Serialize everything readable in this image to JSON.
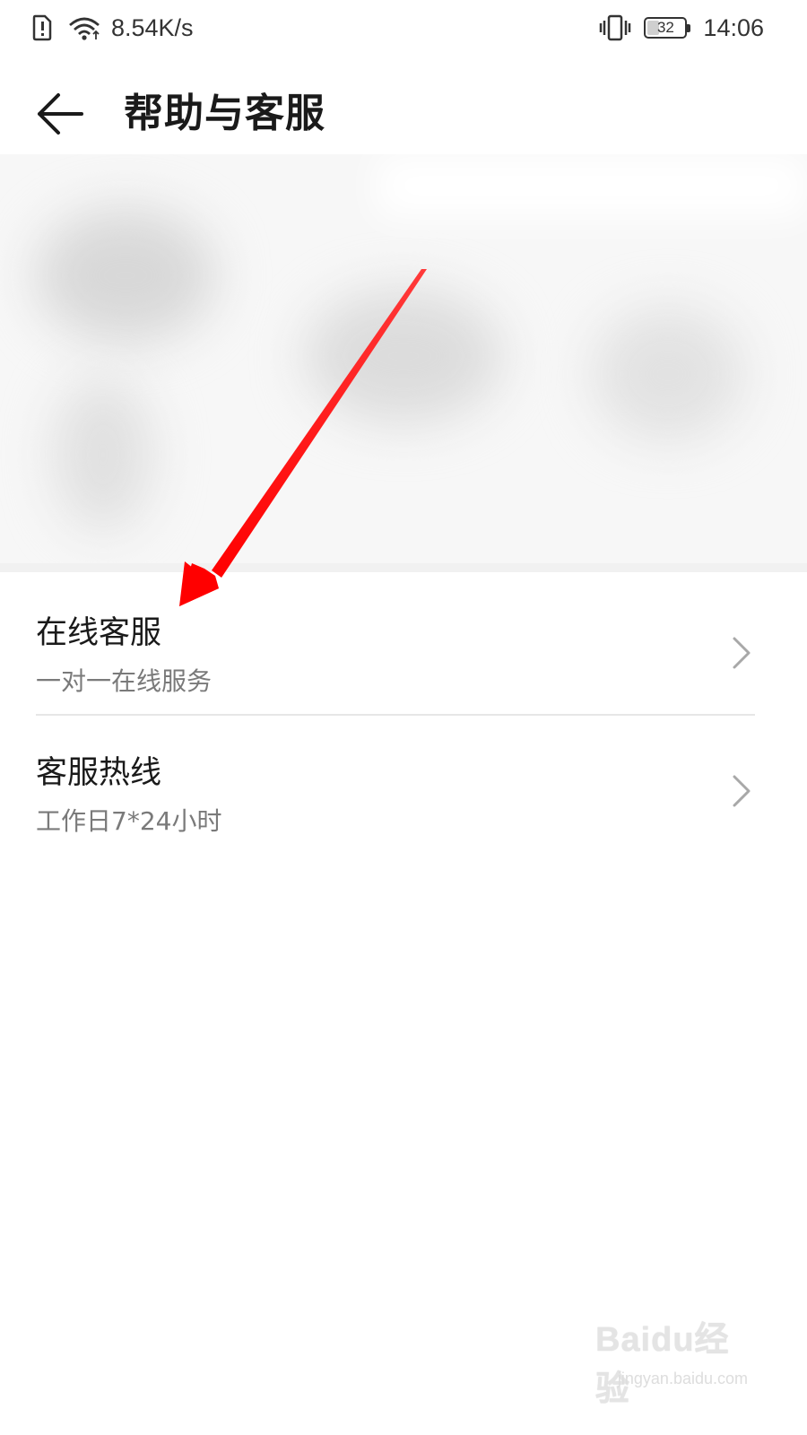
{
  "status_bar": {
    "net_speed": "8.54K/s",
    "battery_level": "32",
    "time": "14:06",
    "icons": [
      "sim-alert-icon",
      "wifi-icon",
      "vibrate-icon",
      "battery-icon"
    ]
  },
  "header": {
    "title": "帮助与客服",
    "back_icon": "arrow-left-icon"
  },
  "banner": {
    "state": "blurred"
  },
  "list": {
    "items": [
      {
        "title": "在线客服",
        "subtitle": "一对一在线服务",
        "icon": "chevron-right-icon"
      },
      {
        "title": "客服热线",
        "subtitle": "工作日7*24小时",
        "icon": "chevron-right-icon"
      }
    ]
  },
  "annotation": {
    "color": "#ff0000",
    "type": "arrow"
  },
  "watermark": {
    "logo": "Baidu经验",
    "url": "jingyan.baidu.com"
  },
  "colors": {
    "text_primary": "#1a1a1a",
    "text_secondary": "#7a7a7a",
    "divider": "#e6e6e6",
    "background": "#ffffff"
  }
}
